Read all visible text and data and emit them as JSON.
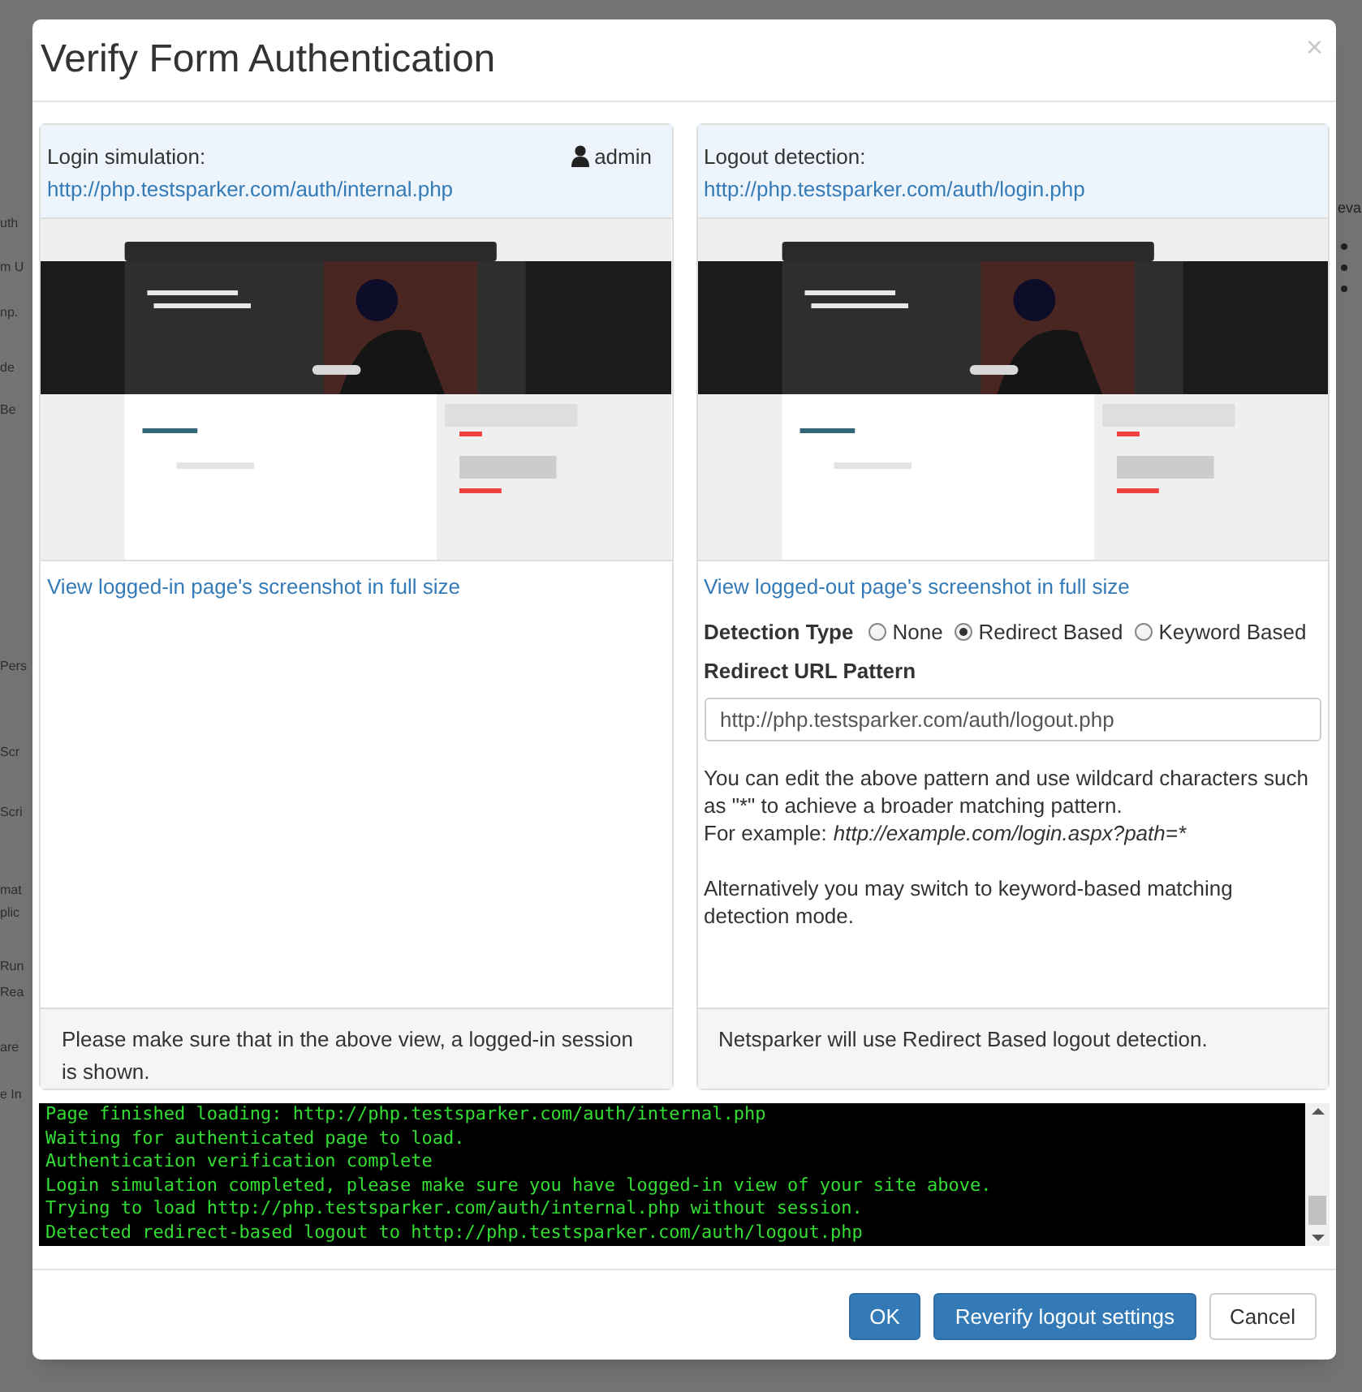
{
  "background": {
    "left_fragments": [
      "uth",
      "m U",
      "np.",
      "de",
      "Be",
      "Pers",
      "Scr",
      "Scri",
      "mat",
      "plic",
      "Run",
      "Rea",
      "are",
      "e In"
    ],
    "right_fragments": [
      "eva"
    ]
  },
  "dialog": {
    "title": "Verify Form Authentication",
    "close": "×"
  },
  "login_panel": {
    "heading": "Login simulation:",
    "url": "http://php.testsparker.com/auth/internal.php",
    "user": "admin",
    "full_size_link": "View logged-in page's screenshot in full size",
    "footer": "Please make sure that in the above view, a logged-in session is shown."
  },
  "logout_panel": {
    "heading": "Logout detection:",
    "url": "http://php.testsparker.com/auth/login.php",
    "full_size_link": "View logged-out page's screenshot in full size",
    "detection_type": {
      "label": "Detection Type",
      "options": [
        {
          "label": "None",
          "selected": false
        },
        {
          "label": "Redirect Based",
          "selected": true
        },
        {
          "label": "Keyword Based",
          "selected": false
        }
      ]
    },
    "pattern_label": "Redirect URL Pattern",
    "pattern_value": "http://php.testsparker.com/auth/logout.php",
    "help": [
      "You can edit the above pattern and use wildcard characters such as \"*\" to achieve a broader matching pattern.",
      "For example:",
      "Alternatively you may switch to keyword-based matching detection mode."
    ],
    "example": "http://example.com/login.aspx?path=*",
    "footer": "Netsparker will use Redirect Based logout detection."
  },
  "console": [
    "Page finished loading: http://php.testsparker.com/auth/internal.php",
    "Waiting for authenticated page to load.",
    "Authentication verification complete",
    "Login simulation completed, please make sure you have logged-in view of your site above.",
    "Trying to load http://php.testsparker.com/auth/internal.php without session.",
    "Detected redirect-based logout to http://php.testsparker.com/auth/logout.php"
  ],
  "buttons": [
    {
      "label": "OK",
      "kind": "primary"
    },
    {
      "label": "Reverify logout settings",
      "kind": "primary"
    },
    {
      "label": "Cancel",
      "kind": "default"
    }
  ]
}
